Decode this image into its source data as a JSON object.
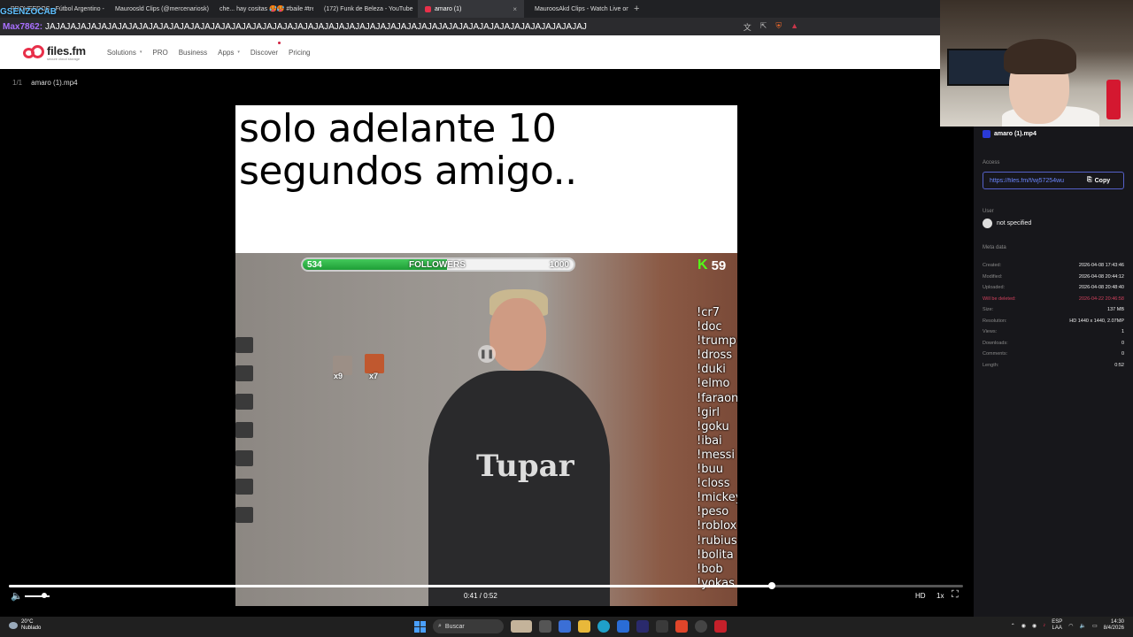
{
  "browser": {
    "tabs": [
      {
        "label": "PROVEEDOS - Fútbol Argentino - E",
        "color": "#e74c3c",
        "active": false
      },
      {
        "label": "Mauroosld Clips (@mercenariosk)",
        "color": "#888888",
        "active": false
      },
      {
        "label": "che... hay cositas 🥵🥵 #baile #tren",
        "color": "#333333",
        "active": false
      },
      {
        "label": "(172) Funk de Beleza - YouTube",
        "color": "#ff0000",
        "active": false
      },
      {
        "label": "amaro (1)",
        "color": "#e8304a",
        "active": true
      },
      {
        "label": "MauroosAkd Clips - Watch Live on Ki",
        "color": "#53fc18",
        "active": false
      }
    ],
    "tab_close": "×",
    "new_tab": "+"
  },
  "stream_overlay": {
    "badge": "GSENZOCAB",
    "chat_user": "Max7862:",
    "chat_message": "JAJAJAJAJAJAJAJAJAJAJAJAJAJAJAJAJAJAJAJAJAJAJAJAJAJAJAJAJAJAJAJAJAJAJAJAJAJAJAJAJAJAJAJAJAJAJAJAJAJAJAJAJ"
  },
  "site": {
    "logo_name": "files.fm",
    "logo_tagline": "secure cloud storage",
    "nav": [
      {
        "label": "Solutions",
        "has_caret": true
      },
      {
        "label": "PRO",
        "has_caret": false
      },
      {
        "label": "Business",
        "has_caret": false
      },
      {
        "label": "Apps",
        "has_caret": true
      },
      {
        "label": "Discover",
        "has_caret": false,
        "dot": true
      },
      {
        "label": "Pricing",
        "has_caret": false
      }
    ]
  },
  "file": {
    "icon": "1/1",
    "title": "amaro (1).mp4"
  },
  "video": {
    "caption": "solo adelante 10 segundos amigo..",
    "followers_current": "534",
    "followers_label": "FOLLOWERS",
    "followers_goal": "1000",
    "followers_progress": 0.534,
    "kick_letter": "K",
    "viewer_count": "59",
    "avatar_labels": [
      "x9",
      "x7"
    ],
    "commands": [
      "!cr7",
      "!doc",
      "!trump",
      "!dross",
      "!duki",
      "!elmo",
      "!faraon",
      "!girl",
      "!goku",
      "!ibai",
      "!messi",
      "!buu",
      "!closs",
      "!mickey",
      "!peso",
      "!roblox",
      "!rubius",
      "!bolita",
      "!bob",
      "!yokas"
    ],
    "shirt_text": "Tupar"
  },
  "player": {
    "timecode": "0:41 / 0:52",
    "progress": 0.8,
    "volume": 0.8,
    "hd_label": "HD",
    "speed_label": "1x"
  },
  "panel": {
    "title": "amaro (1).mp4",
    "access_label": "Access",
    "link": "https://files.fm/f/wj57254wu",
    "copy_label": "Copy",
    "user_label": "User",
    "user_value": "not specified",
    "meta_label": "Meta data",
    "meta": [
      {
        "key": "Created:",
        "value": "2026-04-08 17:43:46",
        "warn": false
      },
      {
        "key": "Modified:",
        "value": "2026-04-08 20:44:12",
        "warn": false
      },
      {
        "key": "Uploaded:",
        "value": "2026-04-08 20:48:40",
        "warn": false
      },
      {
        "key": "Will be deleted:",
        "value": "2026-04-22 20:46:58",
        "warn": true
      },
      {
        "key": "Size:",
        "value": "137 MB",
        "warn": false
      },
      {
        "key": "Resolution:",
        "value": "HD 1440 x 1440, 2.07MP",
        "warn": false
      },
      {
        "key": "Views:",
        "value": "1",
        "warn": false
      },
      {
        "key": "Downloads:",
        "value": "0",
        "warn": false
      },
      {
        "key": "Comments:",
        "value": "0",
        "warn": false
      },
      {
        "key": "Length:",
        "value": "0:52",
        "warn": false
      }
    ]
  },
  "taskbar": {
    "weather_temp": "20°C",
    "weather_desc": "Nublado",
    "search_label": "Buscar",
    "lang_top": "ESP",
    "lang_bottom": "LAA",
    "time": "14:30",
    "date": "8/4/2026"
  }
}
